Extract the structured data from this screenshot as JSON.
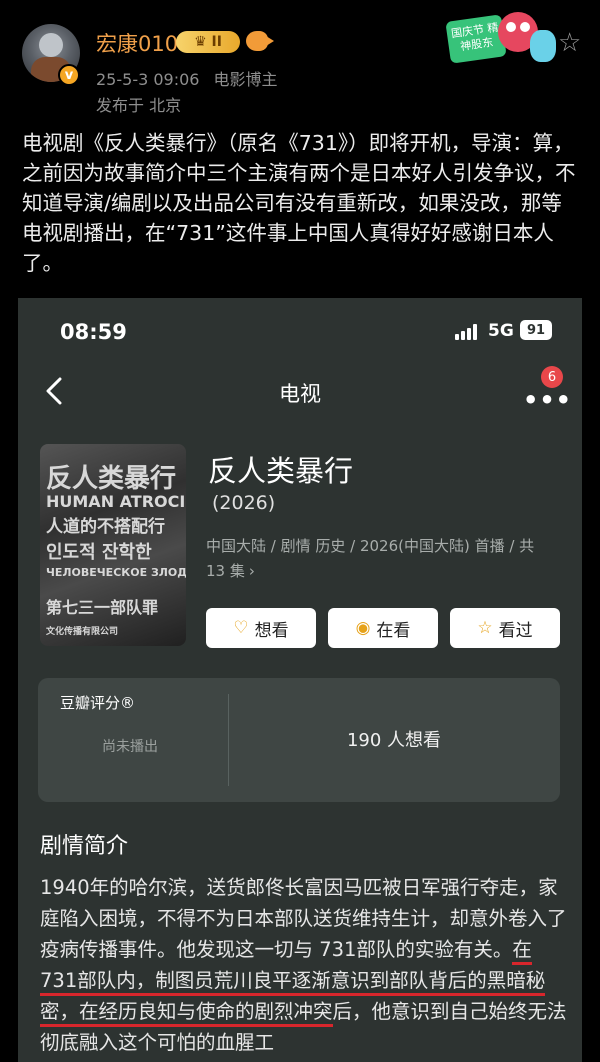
{
  "post": {
    "username": "宏康010",
    "level_badge": "♛ II",
    "verified_mark": "v",
    "time": "25-5-3 09:06",
    "source": "电影博主",
    "location": "发布于 北京",
    "sticker_text": "国庆节 精神股东",
    "text": "电视剧《反人类暴行》（原名《731》）即将开机，导演：算，之前因为故事简介中三个主演有两个是日本好人引发争议，不知道导演/编剧以及出品公司有没有重新改，如果没改，那等电视剧播出，在“731”这件事上中国人真得好好感谢日本人了。"
  },
  "status_bar": {
    "time": "08:59",
    "network": "5G",
    "battery": "91"
  },
  "nav": {
    "title": "电视",
    "badge_count": "6"
  },
  "show": {
    "title": "反人类暴行",
    "year": "(2026)",
    "info": "中国大陆 / 剧情 历史 / 2026(中国大陆) 首播 / 共 13 集",
    "info_chevron": "›",
    "poster_lines": [
      "反人类暴行",
      "HUMAN ATROCI",
      "人道的不搭配行",
      "인도적 잔학한",
      "ЧЕЛОВЕЧЕСКОЕ ЗЛОДЕ",
      "第七三一部队罪",
      "文化传播有限公司"
    ]
  },
  "actions": {
    "want": "想看",
    "watching": "在看",
    "watched": "看过"
  },
  "rating": {
    "label": "豆瓣评分®",
    "status": "尚未播出",
    "wish_count": "190 人想看"
  },
  "synopsis": {
    "heading": "剧情简介",
    "part1": "1940年的哈尔滨，送货郎佟长富因马匹被日军强行夺走，家庭陷入困境，不得不为日本部队送货维持生计，却意外卷入了疫病传播事件。他发现这一切与 731部队的实验有关。",
    "highlight1": "在 731部队内，制图员荒川良平逐渐意识",
    "highlight2": "到部队背后的黑暗秘密，在经历良知与使命的剧烈冲突",
    "part2": "后，他意识到自己始终无法彻底融入这个可怕的血腥工"
  },
  "colors": {
    "username": "#f0a04a",
    "screenshot_bg": "#2d3331",
    "highlight_underline": "#d8262c",
    "button_icon": "#e6a21a"
  }
}
